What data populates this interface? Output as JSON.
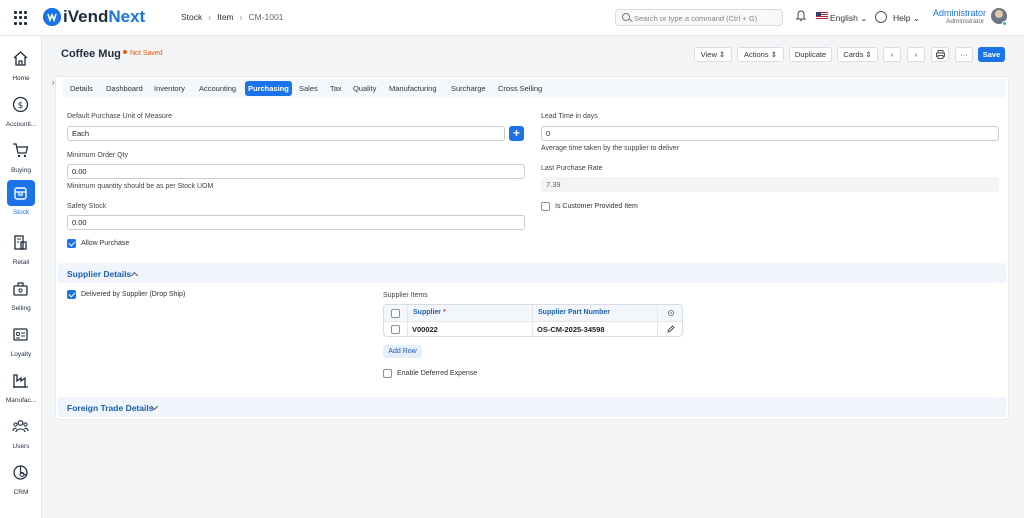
{
  "app": {
    "logo_prefix": "i",
    "logo_brand": "Vend",
    "logo_suffix": "Next",
    "logo_mark": "iV"
  },
  "breadcrumbs": [
    "Stock",
    "Item",
    "CM-1001"
  ],
  "search": {
    "placeholder": "Search or type a command (Ctrl + G)"
  },
  "header_right": {
    "language": "English",
    "help": "Help",
    "user_name": "Administrator",
    "user_role": "Administrator"
  },
  "sidebar": {
    "items": [
      {
        "label": "Home",
        "icon": "home-icon"
      },
      {
        "label": "Accounti...",
        "icon": "dollar-icon"
      },
      {
        "label": "Buying",
        "icon": "cart-icon"
      },
      {
        "label": "Stock",
        "icon": "box-icon",
        "active": true
      },
      {
        "label": "Retail",
        "icon": "store-icon"
      },
      {
        "label": "Selling",
        "icon": "selling-icon"
      },
      {
        "label": "Loyalty",
        "icon": "id-card-icon"
      },
      {
        "label": "Manufac...",
        "icon": "factory-icon"
      },
      {
        "label": "Users",
        "icon": "users-icon"
      },
      {
        "label": "CRM",
        "icon": "crm-icon"
      }
    ]
  },
  "page": {
    "title": "Coffee Mug",
    "status": "Not Saved",
    "buttons": {
      "view": "View",
      "actions": "Actions",
      "duplicate": "Duplicate",
      "cards": "Cards",
      "more": "···",
      "save": "Save"
    }
  },
  "tabs": [
    "Details",
    "Dashboard",
    "Inventory",
    "Accounting",
    "Purchasing",
    "Sales",
    "Tax",
    "Quality",
    "Manufacturing",
    "Surcharge",
    "Cross Selling"
  ],
  "active_tab": "Purchasing",
  "purchasing": {
    "default_uom_label": "Default Purchase Unit of Measure",
    "default_uom_value": "Each",
    "min_order_qty_label": "Minimum Order Qty",
    "min_order_qty_value": "0.00",
    "min_order_qty_help": "Minimum quantity should be as per Stock UOM",
    "safety_stock_label": "Safety Stock",
    "safety_stock_value": "0.00",
    "allow_purchase_label": "Allow Purchase",
    "allow_purchase": true,
    "lead_time_label": "Lead Time in days",
    "lead_time_value": "0",
    "lead_time_help": "Average time taken by the supplier to deliver",
    "last_purchase_rate_label": "Last Purchase Rate",
    "last_purchase_rate_value": "7.39",
    "customer_provided_label": "Is Customer Provided Item",
    "customer_provided": false
  },
  "supplier_details": {
    "title": "Supplier Details",
    "drop_ship_label": "Delivered by Supplier (Drop Ship)",
    "drop_ship": true,
    "supplier_items_label": "Supplier Items",
    "columns": [
      "Supplier",
      "Supplier Part Number"
    ],
    "required_mark": "*",
    "rows": [
      {
        "supplier": "V00022",
        "part_number": "OS-CM-2025-34598"
      }
    ],
    "add_row_label": "Add Row",
    "deferred_expense_label": "Enable Deferred Expense",
    "deferred_expense": false
  },
  "foreign_trade": {
    "title": "Foreign Trade Details"
  },
  "colors": {
    "accent": "#1a73e8",
    "warning": "#e8590c",
    "section_title": "#1a5fb4"
  }
}
